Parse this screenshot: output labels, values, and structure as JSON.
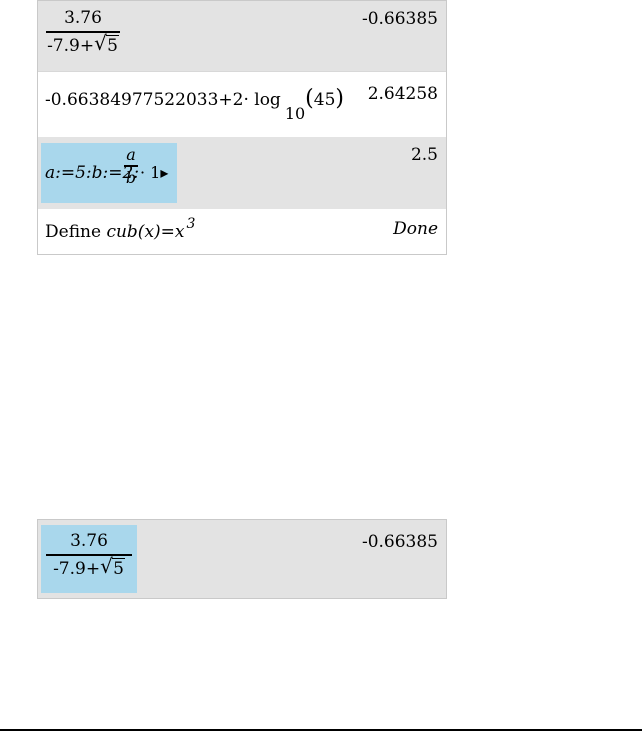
{
  "history": {
    "row1": {
      "numerator": "3.76",
      "denominator_prefix": "-7.9+",
      "radicand": "5",
      "result": "-0.66385"
    },
    "row2": {
      "expr_prefix": "-0.66384977522033+2· log",
      "subscript": "10",
      "argument": "45",
      "result": "2.64258"
    },
    "row3": {
      "expr_left": "a:=5:b:=2:",
      "frac_num": "a",
      "frac_den": "b",
      "expr_right": "· 1▸",
      "result": "2.5"
    },
    "row4": {
      "define_word": "Define",
      "func": "cub(x)=x",
      "exponent": "3",
      "result": "Done"
    }
  },
  "lower": {
    "numerator": "3.76",
    "denominator_prefix": "-7.9+",
    "radicand": "5",
    "result": "-0.66385"
  }
}
